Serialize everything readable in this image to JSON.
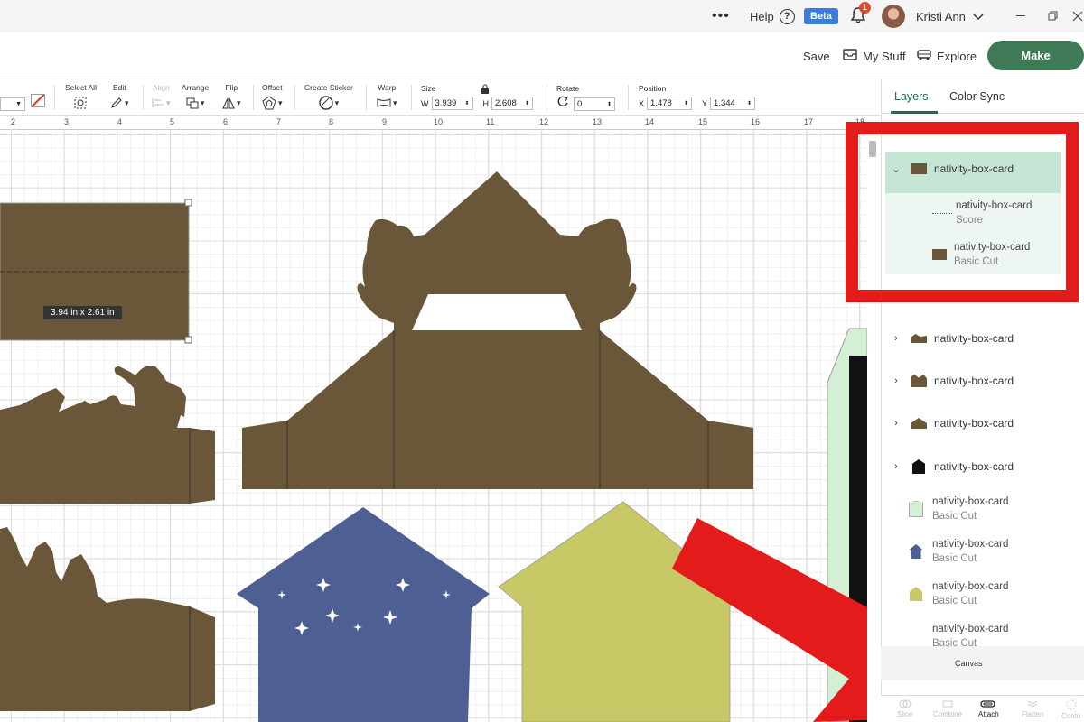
{
  "topbar": {
    "more_label": "•••",
    "help_label": "Help",
    "help_icon": "?",
    "beta_label": "Beta",
    "notification_count": "1",
    "user_name": "Kristi Ann"
  },
  "header": {
    "save_label": "Save",
    "mystuff_label": "My Stuff",
    "explore_label": "Explore",
    "make_label": "Make"
  },
  "toolbar": {
    "select_all": "Select All",
    "edit": "Edit",
    "align": "Align",
    "arrange": "Arrange",
    "flip": "Flip",
    "offset": "Offset",
    "create_sticker": "Create Sticker",
    "warp": "Warp",
    "size": "Size",
    "w_label": "W",
    "w_value": "3.939",
    "h_label": "H",
    "h_value": "2.608",
    "rotate": "Rotate",
    "rotate_value": "0",
    "position": "Position",
    "x_label": "X",
    "x_value": "1.478",
    "y_label": "Y",
    "y_value": "1.344"
  },
  "ruler": [
    "2",
    "3",
    "4",
    "5",
    "6",
    "7",
    "8",
    "9",
    "10",
    "11",
    "12",
    "13",
    "14",
    "15",
    "16",
    "17",
    "18"
  ],
  "canvas": {
    "dimension_tooltip": "3.94  in x 2.61  in"
  },
  "colors": {
    "brown": "#6a573a",
    "blue": "#4e5f93",
    "yellow": "#c9c866",
    "mint": "#d4f0d4",
    "brand_green": "#3d7a55",
    "annotation_red": "#e31b1b"
  },
  "panel": {
    "tab_layers": "Layers",
    "tab_colorsync": "Color Sync",
    "group_title": "nativity-box-card",
    "group_children": [
      {
        "name": "nativity-box-card",
        "type": "Score"
      },
      {
        "name": "nativity-box-card",
        "type": "Basic Cut"
      }
    ],
    "layers": [
      {
        "name": "nativity-box-card",
        "collapsed": true
      },
      {
        "name": "nativity-box-card",
        "collapsed": true
      },
      {
        "name": "nativity-box-card",
        "collapsed": true
      },
      {
        "name": "nativity-box-card",
        "collapsed": true
      }
    ],
    "sub_layers": [
      {
        "name": "nativity-box-card",
        "type": "Basic Cut"
      },
      {
        "name": "nativity-box-card",
        "type": "Basic Cut"
      },
      {
        "name": "nativity-box-card",
        "type": "Basic Cut"
      },
      {
        "name": "nativity-box-card",
        "type": "Basic Cut"
      }
    ],
    "canvas_label": "Canvas",
    "actions": [
      "Slice",
      "Combine",
      "Attach",
      "Flatten",
      "Conto"
    ]
  }
}
